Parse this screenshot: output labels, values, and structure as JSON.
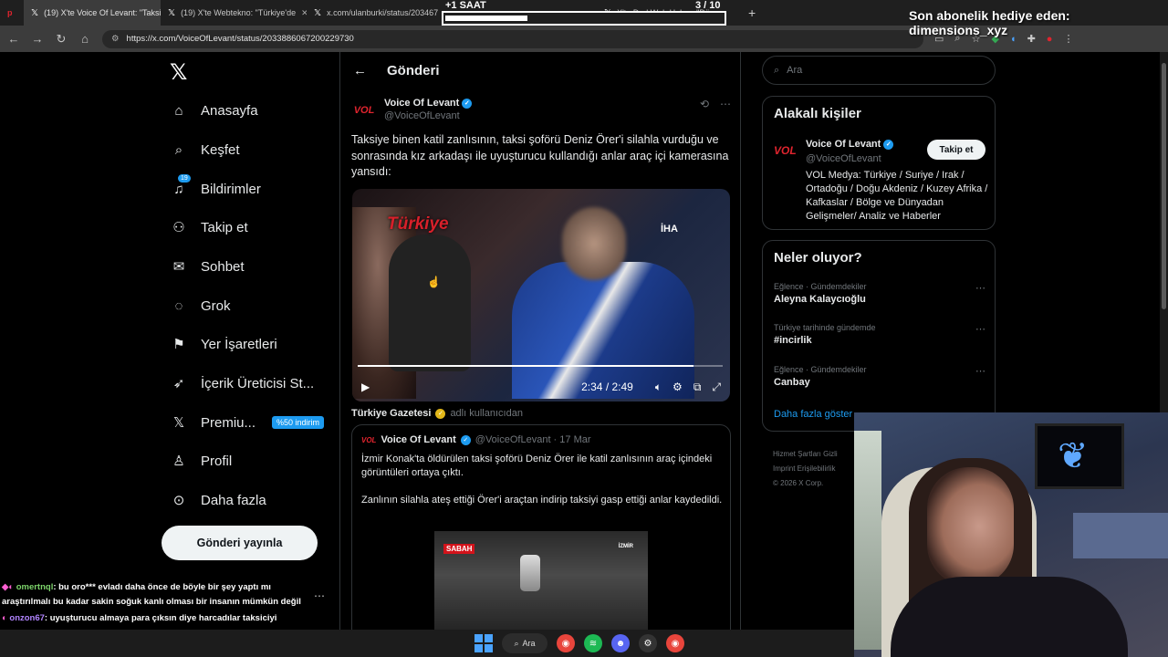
{
  "browser": {
    "tabs": [
      {
        "label": "(19) X'te Voice Of Levant: \"Taksi"
      },
      {
        "label": "(19) X'te Webtekno: \"Türkiye'de"
      },
      {
        "label": "x.com/ulanburki/status/203467"
      },
      {
        "label": "X'te DarkWeb Haber: \"Dünya"
      }
    ],
    "url": "https://x.com/VoiceOfLevant/status/2033886067200229730"
  },
  "overlay": {
    "timer": "+1 SAAT",
    "find_count": "3  / 10",
    "sub_banner": "Son abonelik hediye eden: dimensions_xyz"
  },
  "nav": {
    "items": [
      {
        "label": "Anasayfa"
      },
      {
        "label": "Keşfet"
      },
      {
        "label": "Bildirimler",
        "badge": "19"
      },
      {
        "label": "Takip et"
      },
      {
        "label": "Sohbet"
      },
      {
        "label": "Grok"
      },
      {
        "label": "Yer İşaretleri"
      },
      {
        "label": "İçerik Üreticisi St..."
      },
      {
        "label": "Premiu...",
        "promo": "%50 indirim"
      },
      {
        "label": "Profil"
      },
      {
        "label": "Daha fazla"
      }
    ],
    "post_button": "Gönderi yayınla"
  },
  "main": {
    "header": "Gönderi",
    "author": {
      "avatar_text": "VOL",
      "name": "Voice Of Levant",
      "handle": "@VoiceOfLevant"
    },
    "text": "Taksiye binen katil zanlısının, taksi şoförü Deniz Örer'i silahla vurduğu ve sonrasında kız arkadaşı ile uyuşturucu kullandığı anlar araç içi kamerasına yansıdı:",
    "video": {
      "logo": "Türkiye",
      "agency": "İHA",
      "time": "2:34 / 2:49",
      "progress": 0.92
    },
    "source": {
      "name": "Türkiye Gazetesi",
      "user": "adlı kullanıcıdan"
    },
    "quote": {
      "avatar_text": "VOL",
      "name": "Voice Of Levant",
      "meta": "@VoiceOfLevant · 17 Mar",
      "text1": "İzmir Konak'ta öldürülen taksi şoförü Deniz Örer ile katil zanlısının araç içindeki görüntüleri ortaya çıktı.",
      "text2": "Zanlının silahla ateş ettiği Örer'i araçtan indirip taksiyi gasp ettiği anlar kaydedildi.",
      "image_logo": "SABAH",
      "image_tag": "İZMİR"
    }
  },
  "right": {
    "search_placeholder": "Ara",
    "related": {
      "title": "Alakalı kişiler",
      "avatar_text": "VOL",
      "name": "Voice Of Levant",
      "handle": "@VoiceOfLevant",
      "follow": "Takip et",
      "bio": "VOL Medya: Türkiye / Suriye / Irak / Ortadoğu / Doğu Akdeniz / Kuzey Afrika / Kafkaslar / Bölge ve Dünyadan Gelişmeler/ Analiz ve Haberler"
    },
    "trends": {
      "title": "Neler oluyor?",
      "items": [
        {
          "category": "Eğlence · Gündemdekiler",
          "title": "Aleyna Kalaycıoğlu"
        },
        {
          "category": "Türkiye tarihinde gündemde",
          "title": "#incirlik"
        },
        {
          "category": "Eğlence · Gündemdekiler",
          "title": "Canbay"
        }
      ],
      "more": "Daha fazla göster"
    },
    "footer": {
      "line1": "Hizmet Şartları   Gizli",
      "line2": "Imprint   Erişilebilirlik",
      "line3": "© 2026 X Corp."
    }
  },
  "chat": {
    "msg1_user": "omertnql",
    "msg1_text": ": bu oro*** evladı daha önce de böyle bir şey yaptı mı araştırılmalı bu kadar sakin soğuk kanlı olması bir insanın mümkün değil",
    "msg2_user": "onzon67",
    "msg2_text": ": uyuşturucu almaya para çıksın diye harcadılar taksiciyi"
  },
  "taskbar": {
    "search_label": "Ara"
  }
}
